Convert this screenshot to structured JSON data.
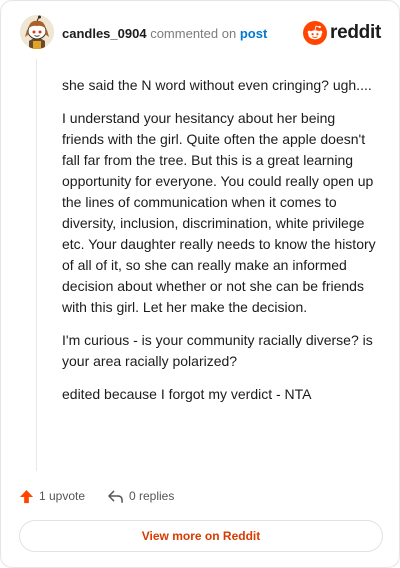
{
  "header": {
    "username": "candles_0904",
    "action_text": "commented on",
    "target_link": "post",
    "brand_wordmark": "reddit"
  },
  "comment": {
    "paragraphs": [
      "she said the N word without even cringing? ugh....",
      "I understand your hesitancy about her being friends with the girl. Quite often the apple doesn't fall far from the tree. But this is a great learning opportunity for everyone. You could really open up the lines of communication when it comes to diversity, inclusion, discrimination, white privilege etc. Your daughter really needs to know the history of all of it, so she can really make an informed decision about whether or not she can be friends with this girl. Let her make the decision.",
      "I'm curious - is your community racially diverse? is your area racially polarized?",
      "edited because I forgot my verdict - NTA"
    ]
  },
  "actions": {
    "upvote_label": "1 upvote",
    "replies_label": "0 replies"
  },
  "footer": {
    "view_more_label": "View more on Reddit"
  },
  "icons": {
    "avatar": "snoo-avatar-icon",
    "brand": "reddit-logo-icon",
    "upvote": "upvote-arrow-icon",
    "reply": "reply-arrow-icon"
  },
  "colors": {
    "accent_orange": "#ff4500",
    "link_blue": "#0079d3",
    "view_more_text": "#d93a00",
    "border": "#e5e5e5"
  }
}
